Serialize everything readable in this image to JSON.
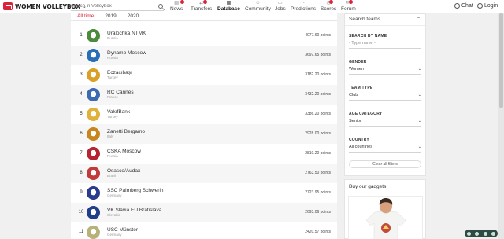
{
  "app": {
    "logo_text": "WOMEN VOLLEYBOX",
    "search_placeholder": "search in Volleybox",
    "nav": [
      {
        "label": "News",
        "icon": "news-icon"
      },
      {
        "label": "Transfers",
        "icon": "transfers-icon"
      },
      {
        "label": "Database",
        "icon": "database-icon",
        "active": true
      },
      {
        "label": "Community",
        "icon": "community-icon"
      },
      {
        "label": "Jobs",
        "icon": "jobs-icon"
      },
      {
        "label": "Predictions",
        "icon": "predictions-icon"
      },
      {
        "label": "Scores",
        "icon": "scores-icon"
      },
      {
        "label": "Forum",
        "icon": "forum-icon"
      }
    ],
    "chat_label": "Chat",
    "login_label": "Login"
  },
  "tabs": [
    "All time",
    "2019",
    "2020"
  ],
  "ranking": [
    {
      "rank": "1",
      "name": "Uralochka NTMK",
      "country": "Russia",
      "points": "4077.60 points",
      "color": "#4c8a3c"
    },
    {
      "rank": "2",
      "name": "Dynamo Moscow",
      "country": "Russia",
      "points": "3697.65 points",
      "color": "#2a6fb5"
    },
    {
      "rank": "3",
      "name": "Eczacıbaşı",
      "country": "Turkey",
      "points": "3182.20 points",
      "color": "#d9a227"
    },
    {
      "rank": "4",
      "name": "RC Cannes",
      "country": "France",
      "points": "3432.20 points",
      "color": "#3c6bb0"
    },
    {
      "rank": "5",
      "name": "VakıfBank",
      "country": "Turkey",
      "points": "3386.20 points",
      "color": "#e0b23c"
    },
    {
      "rank": "6",
      "name": "Zanetti Bergamo",
      "country": "Italy",
      "points": "2928.00 points",
      "color": "#c8861e"
    },
    {
      "rank": "7",
      "name": "CSKA Moscow",
      "country": "Russia",
      "points": "2810.20 points",
      "color": "#b5252f"
    },
    {
      "rank": "8",
      "name": "Osasco/Audax",
      "country": "Brazil",
      "points": "2763.50 points",
      "color": "#c23a3a"
    },
    {
      "rank": "9",
      "name": "SSC Palmberg Schwerin",
      "country": "Germany",
      "points": "2723.95 points",
      "color": "#2b3b8f"
    },
    {
      "rank": "10",
      "name": "VK Slavia EU Bratislava",
      "country": "Slovakia",
      "points": "2693.06 points",
      "color": "#1f3f8a"
    },
    {
      "rank": "11",
      "name": "USC Münster",
      "country": "Germany",
      "points": "2420.57 points",
      "color": "#b7b27a"
    }
  ],
  "filters": {
    "title": "Search teams",
    "fields": [
      {
        "label": "SEARCH BY NAME",
        "value": "- Type name -",
        "placeholder": true,
        "dropdown": false
      },
      {
        "label": "GENDER",
        "value": "Women",
        "placeholder": false,
        "dropdown": true
      },
      {
        "label": "TEAM TYPE",
        "value": "Club",
        "placeholder": false,
        "dropdown": true
      },
      {
        "label": "AGE CATEGORY",
        "value": "Senior",
        "placeholder": false,
        "dropdown": true
      },
      {
        "label": "COUNTRY",
        "value": "All countries",
        "placeholder": false,
        "dropdown": true
      }
    ],
    "clear_label": "Clear all filters"
  },
  "gadgets": {
    "title": "Buy our gadgets"
  }
}
